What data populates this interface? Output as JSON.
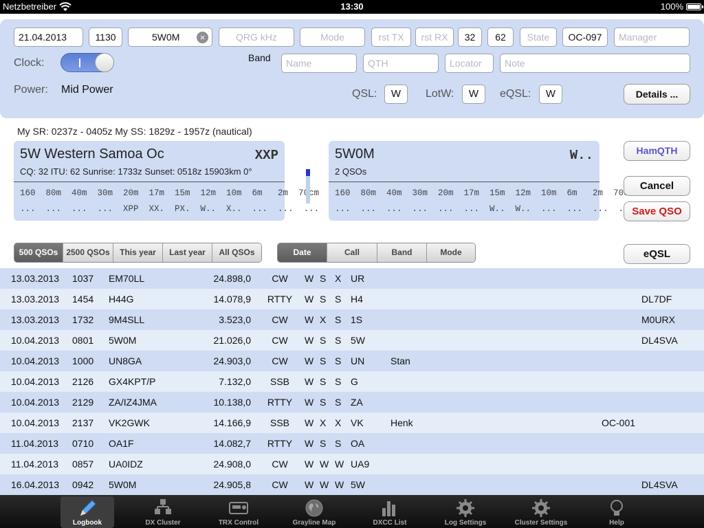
{
  "status_bar": {
    "carrier": "Netzbetreiber",
    "time": "13:30",
    "battery": "100%"
  },
  "entry": {
    "date": "21.04.2013",
    "time": "1130",
    "call": "5W0M",
    "qrg_placeholder": "QRG kHz",
    "mode_placeholder": "Mode",
    "rst_tx_placeholder": "rst TX",
    "rst_rx_placeholder": "rst RX",
    "cq_zone": "32",
    "itu_zone": "62",
    "state_placeholder": "State",
    "iota": "OC-097",
    "manager_placeholder": "Manager",
    "clock_label": "Clock:",
    "band_label": "Band",
    "name_placeholder": "Name",
    "qth_placeholder": "QTH",
    "locator_placeholder": "Locator",
    "note_placeholder": "Note",
    "power_label": "Power:",
    "power_value": "Mid Power",
    "qsl_label": "QSL:",
    "qsl_value": "W",
    "lotw_label": "LotW:",
    "lotw_value": "W",
    "eqsl_label": "eQSL:",
    "eqsl_value": "W",
    "details_button": "Details ..."
  },
  "sun_info": "My SR: 0237z - 0405z   My SS: 1829z - 1957z (nautical)",
  "dxcc_card": {
    "title": "5W  Western Samoa  Oc",
    "code": "XXP",
    "info": "CQ: 32  ITU: 62  Sunrise: 1733z  Sunset: 0518z  15903km  0°",
    "bands": "160  80m  40m  30m  20m  17m  15m  12m  10m  6m   2m  70cm",
    "status": "...  ...  ...  ...  XPP  XX.  PX.  W..  X..  ...  ...  ..."
  },
  "call_card": {
    "title": "5W0M",
    "code": "W..",
    "info": "2 QSOs",
    "bands": "160  80m  40m  30m  20m  17m  15m  12m  10m  6m   2m  70cm",
    "status": "...  ...  ...  ...  ...  ...  W..  W..  ...  ...  ...  ..."
  },
  "meter_level": 0.2,
  "buttons": {
    "hamqth": "HamQTH",
    "cancel": "Cancel",
    "save": "Save QSO",
    "eqsl": "eQSL"
  },
  "filter_segments": [
    {
      "label": "500 QSOs",
      "active": true
    },
    {
      "label": "2500 QSOs",
      "active": false
    },
    {
      "label": "This year",
      "active": false
    },
    {
      "label": "Last year",
      "active": false
    },
    {
      "label": "All QSOs",
      "active": false
    }
  ],
  "sort_segments": [
    {
      "label": "Date",
      "active": true
    },
    {
      "label": "Call",
      "active": false
    },
    {
      "label": "Band",
      "active": false
    },
    {
      "label": "Mode",
      "active": false
    }
  ],
  "qso_rows": [
    {
      "date": "13.03.2013",
      "time": "1037",
      "call": "EM70LL",
      "freq": "24.898,0",
      "mode": "CW",
      "q1": "W",
      "q2": "S",
      "q3": "X",
      "pfx": "UR",
      "name": "",
      "iota": "",
      "mgr": ""
    },
    {
      "date": "13.03.2013",
      "time": "1454",
      "call": "H44G",
      "freq": "14.078,9",
      "mode": "RTTY",
      "q1": "W",
      "q2": "S",
      "q3": "S",
      "pfx": "H4",
      "name": "",
      "iota": "",
      "mgr": "DL7DF"
    },
    {
      "date": "13.03.2013",
      "time": "1732",
      "call": "9M4SLL",
      "freq": "3.523,0",
      "mode": "CW",
      "q1": "W",
      "q2": "X",
      "q3": "S",
      "pfx": "1S",
      "name": "",
      "iota": "",
      "mgr": "M0URX"
    },
    {
      "date": "10.04.2013",
      "time": "0801",
      "call": "5W0M",
      "freq": "21.026,0",
      "mode": "CW",
      "q1": "W",
      "q2": "S",
      "q3": "S",
      "pfx": "5W",
      "name": "",
      "iota": "",
      "mgr": "DL4SVA"
    },
    {
      "date": "10.04.2013",
      "time": "1000",
      "call": "UN8GA",
      "freq": "24.903,0",
      "mode": "CW",
      "q1": "W",
      "q2": "S",
      "q3": "S",
      "pfx": "UN",
      "name": "Stan",
      "iota": "",
      "mgr": ""
    },
    {
      "date": "10.04.2013",
      "time": "2126",
      "call": "GX4KPT/P",
      "freq": "7.132,0",
      "mode": "SSB",
      "q1": "W",
      "q2": "S",
      "q3": "S",
      "pfx": "G",
      "name": "",
      "iota": "",
      "mgr": ""
    },
    {
      "date": "10.04.2013",
      "time": "2129",
      "call": "ZA/IZ4JMA",
      "freq": "10.138,0",
      "mode": "RTTY",
      "q1": "W",
      "q2": "S",
      "q3": "S",
      "pfx": "ZA",
      "name": "",
      "iota": "",
      "mgr": ""
    },
    {
      "date": "10.04.2013",
      "time": "2137",
      "call": "VK2GWK",
      "freq": "14.166,9",
      "mode": "SSB",
      "q1": "W",
      "q2": "X",
      "q3": "X",
      "pfx": "VK",
      "name": "Henk",
      "iota": "OC-001",
      "mgr": ""
    },
    {
      "date": "11.04.2013",
      "time": "0710",
      "call": "OA1F",
      "freq": "14.082,7",
      "mode": "RTTY",
      "q1": "W",
      "q2": "S",
      "q3": "S",
      "pfx": "OA",
      "name": "",
      "iota": "",
      "mgr": ""
    },
    {
      "date": "11.04.2013",
      "time": "0857",
      "call": "UA0IDZ",
      "freq": "24.908,0",
      "mode": "CW",
      "q1": "W",
      "q2": "W",
      "q3": "W",
      "pfx": "UA9",
      "name": "",
      "iota": "",
      "mgr": ""
    },
    {
      "date": "16.04.2013",
      "time": "0942",
      "call": "5W0M",
      "freq": "24.905,8",
      "mode": "CW",
      "q1": "W",
      "q2": "W",
      "q3": "W",
      "pfx": "5W",
      "name": "",
      "iota": "",
      "mgr": "DL4SVA"
    }
  ],
  "tabs": [
    {
      "label": "Logbook",
      "icon": "pencil-icon",
      "active": true
    },
    {
      "label": "DX Cluster",
      "icon": "cluster-icon",
      "active": false
    },
    {
      "label": "TRX Control",
      "icon": "radio-icon",
      "active": false
    },
    {
      "label": "Grayline Map",
      "icon": "globe-icon",
      "active": false
    },
    {
      "label": "DXCC List",
      "icon": "bar-chart-icon",
      "active": false
    },
    {
      "label": "Log Settings",
      "icon": "gear-icon",
      "active": false
    },
    {
      "label": "Cluster Settings",
      "icon": "gear-icon",
      "active": false
    },
    {
      "label": "Help",
      "icon": "lightbulb-icon",
      "active": false
    }
  ],
  "colors": {
    "panel": "#cfdcf3",
    "row_alt": "#e4edf8",
    "save_red": "#d11a1a",
    "hamqth_blue": "#5d55c9"
  }
}
